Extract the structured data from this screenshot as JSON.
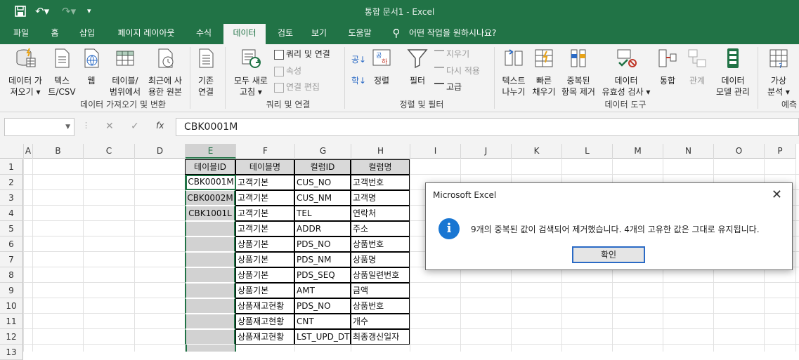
{
  "window": {
    "title": "통합 문서1  -  Excel"
  },
  "qat": {
    "save_icon": "save-icon",
    "undo_icon": "undo-icon",
    "redo_icon": "redo-icon",
    "more_icon": "customize-icon"
  },
  "tabs": [
    {
      "label": "파일",
      "active": false
    },
    {
      "label": "홈",
      "active": false
    },
    {
      "label": "삽입",
      "active": false
    },
    {
      "label": "페이지 레이아웃",
      "active": false
    },
    {
      "label": "수식",
      "active": false
    },
    {
      "label": "데이터",
      "active": true
    },
    {
      "label": "검토",
      "active": false
    },
    {
      "label": "보기",
      "active": false
    },
    {
      "label": "도움말",
      "active": false
    }
  ],
  "tellme": "어떤 작업을 원하시나요?",
  "ribbon": {
    "get_data": {
      "label1": "데이터 가",
      "label2": "져오기 ▾"
    },
    "text_csv": {
      "label1": "텍스",
      "label2": "트/CSV"
    },
    "web": {
      "label1": "웹"
    },
    "from_table": {
      "label1": "테이블/",
      "label2": "범위에서"
    },
    "recent": {
      "label1": "최근에 사",
      "label2": "용한 원본"
    },
    "existing": {
      "label1": "기존",
      "label2": "연결"
    },
    "group_get": "데이터 가져오기 및 변환",
    "refresh_all": {
      "label1": "모두 새로",
      "label2": "고침 ▾"
    },
    "queries": "쿼리 및 연결",
    "properties": "속성",
    "edit_links": "연결 편집",
    "group_queries": "쿼리 및 연결",
    "sort_asc": "공↓",
    "sort_desc": "학↓",
    "sort": "정렬",
    "filter": "필터",
    "clear": "지우기",
    "reapply": "다시 적용",
    "advanced": "고급",
    "group_sort": "정렬 및 필터",
    "text_to_columns": {
      "label1": "텍스트",
      "label2": "나누기"
    },
    "flash_fill": {
      "label1": "빠른",
      "label2": "채우기"
    },
    "remove_dup": {
      "label1": "중복된",
      "label2": "항목 제거"
    },
    "validation": {
      "label1": "데이터",
      "label2": "유효성 검사 ▾"
    },
    "consolidate": {
      "label1": "통합"
    },
    "relations": {
      "label1": "관계"
    },
    "data_model": {
      "label1": "데이터",
      "label2": "모델 관리"
    },
    "group_tools": "데이터 도구",
    "whatif": {
      "label1": "가상",
      "label2": "분석 ▾"
    },
    "group_forecast": "예측"
  },
  "formula_bar": {
    "name_box": "",
    "cancel": "✕",
    "enter": "✓",
    "fx": "fx",
    "value": "CBK0001M"
  },
  "sheet": {
    "columns": [
      "A",
      "B",
      "C",
      "D",
      "E",
      "F",
      "G",
      "H",
      "I",
      "J",
      "K",
      "L",
      "M",
      "N",
      "O",
      "P"
    ],
    "selected_column": "E",
    "rows": [
      "1",
      "2",
      "3",
      "4",
      "5",
      "6",
      "7",
      "8",
      "9",
      "10",
      "11",
      "12",
      "13"
    ],
    "header_row": [
      "테이블ID",
      "테이블명",
      "컬럼ID",
      "컬럼명"
    ],
    "data": [
      [
        "CBK0001M",
        "고객기본",
        "CUS_NO",
        "고객번호"
      ],
      [
        "CBK0002M",
        "고객기본",
        "CUS_NM",
        "고객명"
      ],
      [
        "CBK1001L",
        "고객기본",
        "TEL",
        "연락처"
      ],
      [
        "",
        "고객기본",
        "ADDR",
        "주소"
      ],
      [
        "",
        "상품기본",
        "PDS_NO",
        "상품번호"
      ],
      [
        "",
        "상품기본",
        "PDS_NM",
        "상품명"
      ],
      [
        "",
        "상품기본",
        "PDS_SEQ",
        "상품일련번호"
      ],
      [
        "",
        "상품기본",
        "AMT",
        "금액"
      ],
      [
        "",
        "상품재고현황",
        "PDS_NO",
        "상품번호"
      ],
      [
        "",
        "상품재고현황",
        "CNT",
        "개수"
      ],
      [
        "",
        "상품재고현황",
        "LST_UPD_DT",
        "최종갱신일자"
      ]
    ]
  },
  "dialog": {
    "title": "Microsoft Excel",
    "close": "✕",
    "info_icon": "i",
    "message": "9개의 중복된 값이 검색되어 제거했습니다. 4개의 고유한 값은 그대로 유지됩니다.",
    "ok": "확인"
  },
  "colors": {
    "accent": "#217346",
    "dialog_button": "#2a6ac5",
    "header_fill": "#d9d9d9",
    "selection": "#d2d2d2"
  }
}
